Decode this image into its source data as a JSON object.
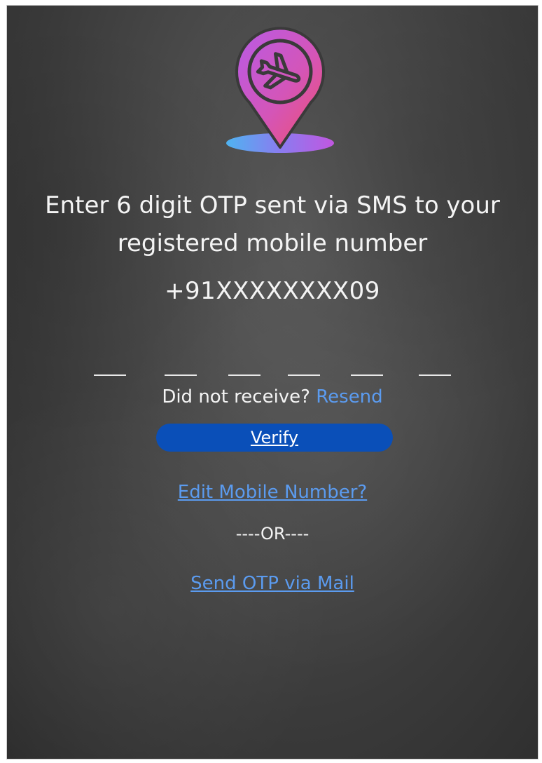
{
  "logo": {
    "icon": "airplane-location-pin-icon",
    "gradient": [
      "#f0506e",
      "#c157e0",
      "#8a5cf0",
      "#4fb3f0"
    ]
  },
  "headline": {
    "line1": "Enter 6 digit OTP sent via SMS to your",
    "line2": "registered mobile number"
  },
  "phone_number": "+91XXXXXXXX09",
  "otp": {
    "digits": 6,
    "values": [
      "",
      "",
      "",
      "",
      "",
      ""
    ]
  },
  "resend": {
    "prompt": "Did not receive?",
    "link_label": "Resend"
  },
  "verify_button": {
    "label": "Verify"
  },
  "edit_mobile": {
    "label": "Edit Mobile Number?"
  },
  "divider": {
    "label": "----OR----"
  },
  "send_mail": {
    "label": "Send OTP via Mail"
  },
  "colors": {
    "background": "#4a4a4a",
    "text": "#f4f4f4",
    "link": "#5b9bef",
    "button": "#0a4fb8"
  }
}
